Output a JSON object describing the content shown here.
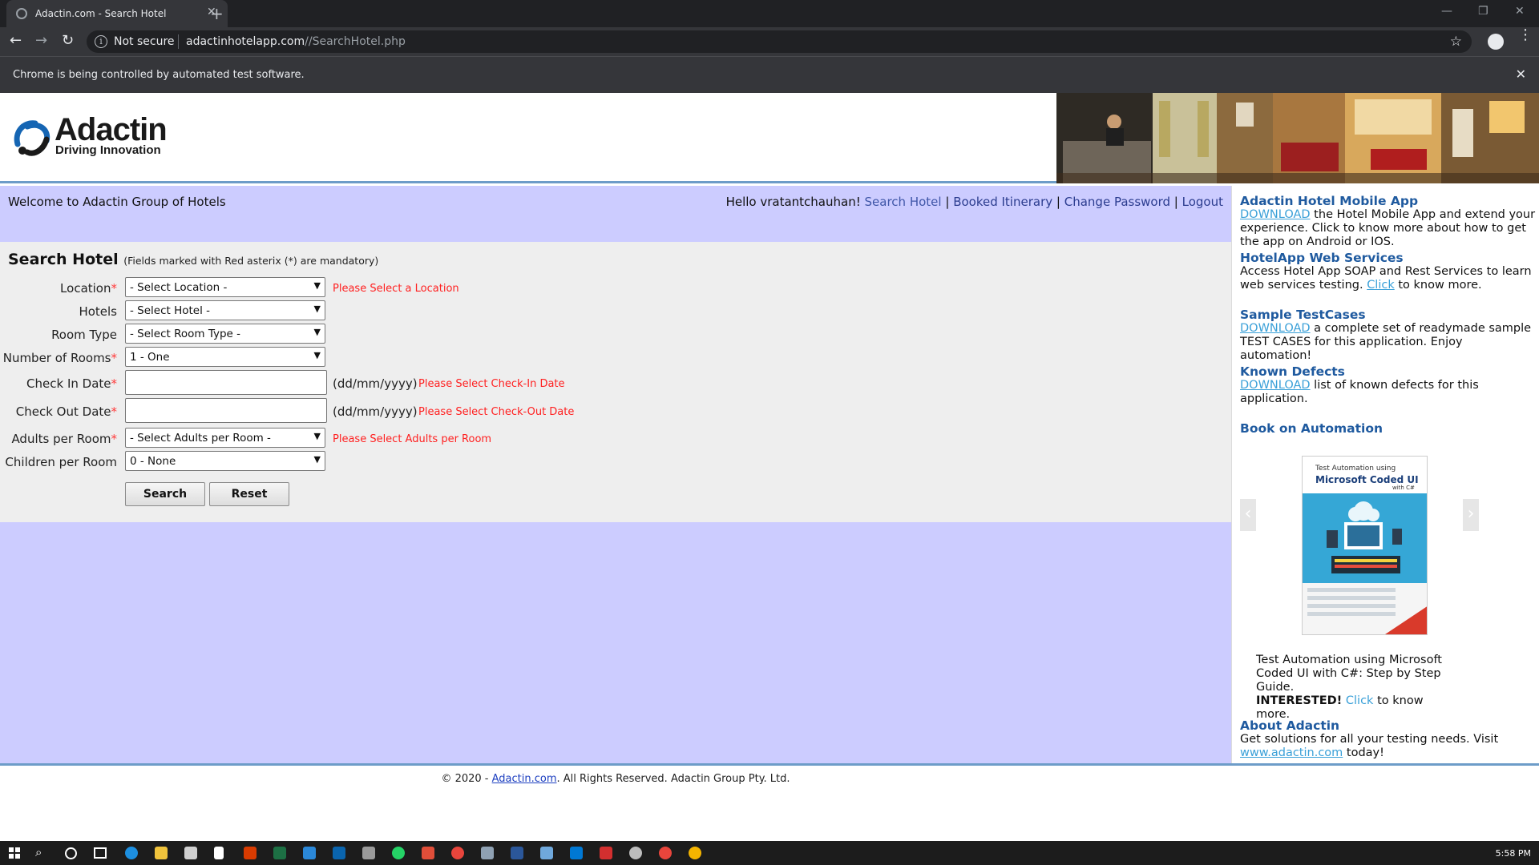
{
  "browser": {
    "tab_title": "Adactin.com - Search Hotel",
    "security_label": "Not secure",
    "url_host": "adactinhotelapp.com",
    "url_path": "//SearchHotel.php",
    "automation_banner": "Chrome is being controlled by automated test software."
  },
  "header": {
    "logo_name": "Adactin",
    "logo_tagline": "Driving Innovation"
  },
  "topbar": {
    "welcome": "Welcome to Adactin Group of Hotels",
    "greeting": "Hello vratantchauhan!",
    "nav": {
      "search_hotel": "Search Hotel",
      "booked_itinerary": "Booked Itinerary",
      "change_password": "Change Password",
      "logout": "Logout",
      "separator": "|"
    }
  },
  "form": {
    "title": "Search Hotel",
    "note": "(Fields marked with Red asterix (*) are mandatory)",
    "required_mark": "*",
    "date_format": "(dd/mm/yyyy)",
    "location": {
      "label": "Location",
      "value": "- Select Location -",
      "error": "Please Select a Location"
    },
    "hotels": {
      "label": "Hotels",
      "value": "- Select Hotel -"
    },
    "room_type": {
      "label": "Room Type",
      "value": "- Select Room Type -"
    },
    "rooms": {
      "label": "Number of Rooms",
      "value": "1 - One"
    },
    "check_in": {
      "label": "Check In Date",
      "value": "",
      "error": "Please Select Check-In Date"
    },
    "check_out": {
      "label": "Check Out Date",
      "value": "",
      "error": "Please Select Check-Out Date"
    },
    "adults": {
      "label": "Adults per Room",
      "value": "- Select Adults per Room -",
      "error": "Please Select Adults per Room"
    },
    "children": {
      "label": "Children per Room",
      "value": "0 - None"
    },
    "search_button": "Search",
    "reset_button": "Reset"
  },
  "sidebar": {
    "app": {
      "heading": "Adactin Hotel Mobile App",
      "link": "DOWNLOAD",
      "text": " the Hotel Mobile App and extend your experience. Click to know more about how to get the app on Android or IOS."
    },
    "web_services": {
      "heading": "HotelApp Web Services",
      "text_before": "Access Hotel App SOAP and Rest Services to learn web services testing. ",
      "link": "Click",
      "text_after": " to know more."
    },
    "testcases": {
      "heading": "Sample TestCases",
      "link": "DOWNLOAD",
      "text": " a complete set of readymade sample TEST CASES for this application. Enjoy automation!"
    },
    "defects": {
      "heading": "Known Defects",
      "link": "DOWNLOAD",
      "text": " list of known defects for this application."
    },
    "book": {
      "heading": "Book on Automation",
      "cover_small": "Test Automation using",
      "cover_title": "Microsoft Coded UI",
      "cover_sub": "with C#",
      "caption": "Test Automation using Microsoft Coded UI with C#: Step by Step Guide.",
      "interested": "INTERESTED!",
      "link": "Click",
      "text_after": " to know more."
    },
    "about": {
      "heading": "About Adactin",
      "text_before": "Get solutions for all your testing needs. Visit ",
      "link": "www.adactin.com",
      "text_after": " today!"
    }
  },
  "footer": {
    "before": "© 2020 - ",
    "link": "Adactin.com",
    "after": ". All Rights Reserved. Adactin Group Pty. Ltd."
  },
  "taskbar": {
    "clock": "5:58 PM"
  },
  "colors": {
    "main_background": "#ccccff",
    "form_background": "#eeeeee",
    "error_red": "#ff2020",
    "heading_blue": "#1f5a9f",
    "link_blue": "#3aa0d8"
  }
}
